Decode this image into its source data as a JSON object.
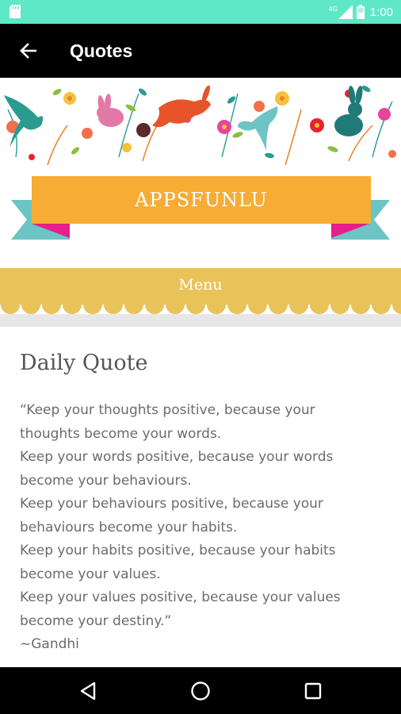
{
  "status_bar": {
    "network_label": "4G",
    "time": "1:00",
    "icons": [
      "sd-card-icon",
      "signal-icon",
      "battery-icon"
    ]
  },
  "app_bar": {
    "back_icon": "arrow-back-icon",
    "title": "Quotes"
  },
  "header": {
    "banner_text": "APPSFUNLU",
    "menu_label": "Menu"
  },
  "content": {
    "heading": "Daily Quote",
    "quote_lines": [
      "“Keep your thoughts positive, because your",
      "thoughts become your words.",
      "Keep your words positive, because your words",
      "become your behaviours.",
      "Keep your behaviours positive, because your",
      "behaviours become your habits.",
      "Keep your habits positive, because your habits",
      "become your values.",
      "Keep your values positive, because your values",
      "become your destiny.”",
      "~Gandhi"
    ]
  },
  "nav_bar": {
    "icons": [
      "back-triangle-icon",
      "home-circle-icon",
      "recents-square-icon"
    ]
  },
  "colors": {
    "status_bar": "#5fe8c8",
    "app_bar": "#000000",
    "banner_orange": "#f6ac35",
    "banner_teal": "#6cc4c4",
    "banner_pink": "#e81e8c",
    "menu_yellow": "#e9c35a",
    "text_gray": "#6b6b6b"
  }
}
